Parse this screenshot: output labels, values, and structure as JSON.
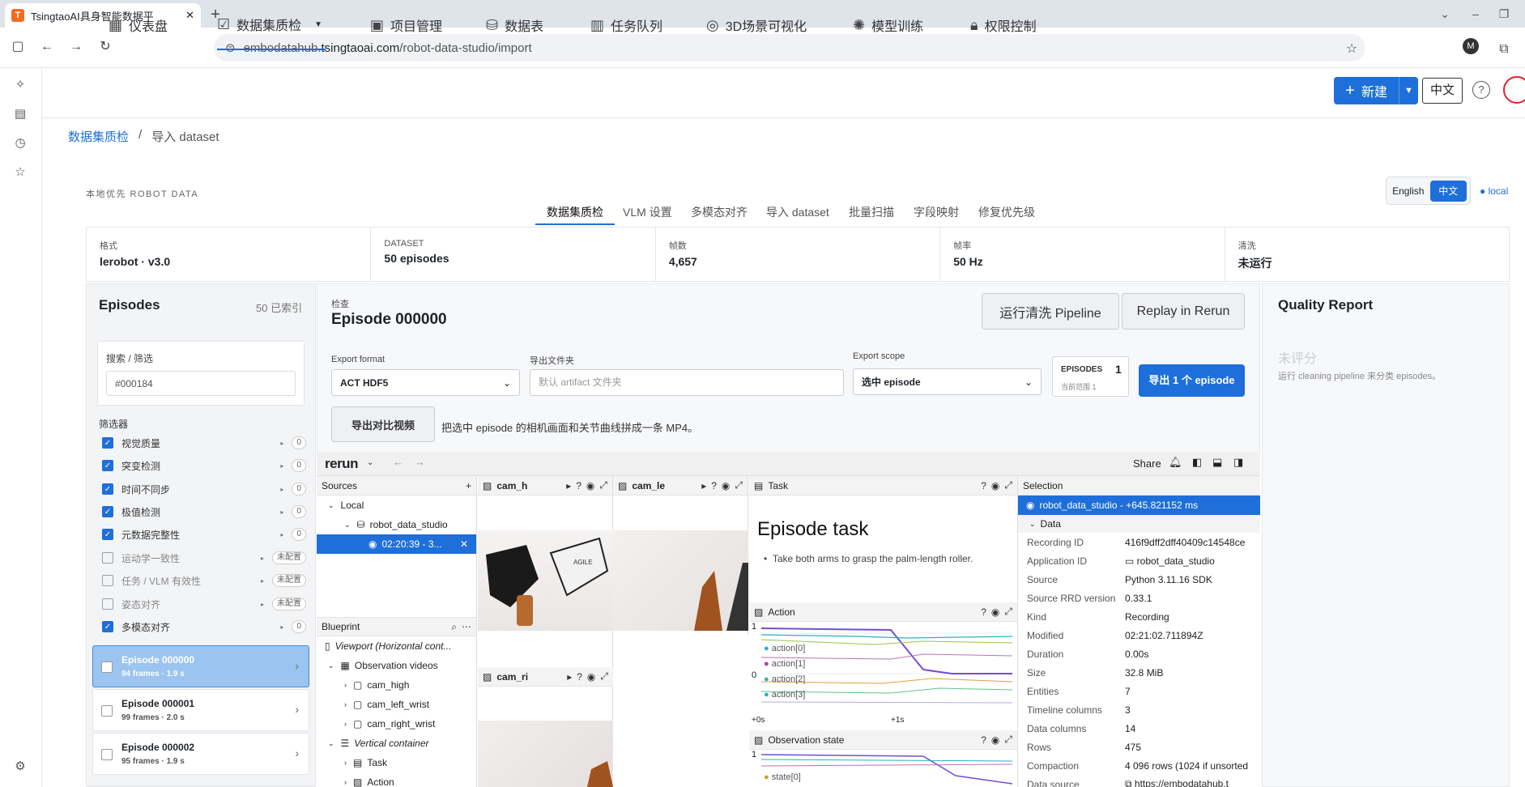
{
  "browser": {
    "tab_title": "TsingtaoAI具身智能数据平",
    "url_prefix": "embodatahub.",
    "url_host": "tsingtaoai.com",
    "url_path": "/robot-data-studio/import",
    "profile": "M"
  },
  "nav": {
    "items": [
      "仪表盘",
      "数据集质检",
      "项目管理",
      "数据表",
      "任务队列",
      "3D场景可视化",
      "模型训练",
      "权限控制"
    ],
    "new_label": "新建",
    "lang": "中文"
  },
  "breadcrumb": {
    "parent": "数据集质检",
    "sep": "/",
    "current": "导入 dataset"
  },
  "studio": {
    "brand": "本地优先 ROBOT DATA",
    "tabs": [
      "数据集质检",
      "VLM 设置",
      "多模态对齐",
      "导入 dataset",
      "批量扫描",
      "字段映射",
      "修复优先级"
    ],
    "lang_en": "English",
    "lang_zh": "中文",
    "local": "local"
  },
  "stats": [
    {
      "k": "格式",
      "v": "lerobot · v3.0"
    },
    {
      "k": "DATASET",
      "v": "50 episodes"
    },
    {
      "k": "帧数",
      "v": "4,657"
    },
    {
      "k": "帧率",
      "v": "50 Hz"
    },
    {
      "k": "清洗",
      "v": "未运行"
    }
  ],
  "episodes": {
    "title": "Episodes",
    "count": "50 已索引",
    "search_label": "搜索 / 筛选",
    "search_value": "#000184",
    "filter_label": "筛选器",
    "filters": [
      {
        "name": "视觉质量",
        "on": true,
        "badge": "0"
      },
      {
        "name": "突变检测",
        "on": true,
        "badge": "0"
      },
      {
        "name": "时间不同步",
        "on": true,
        "badge": "0"
      },
      {
        "name": "极值检测",
        "on": true,
        "badge": "0"
      },
      {
        "name": "元数据完整性",
        "on": true,
        "badge": "0"
      },
      {
        "name": "运动学一致性",
        "on": false,
        "badge": "未配置"
      },
      {
        "name": "任务 / VLM 有效性",
        "on": false,
        "badge": "未配置"
      },
      {
        "name": "姿态对齐",
        "on": false,
        "badge": "未配置"
      },
      {
        "name": "多模态对齐",
        "on": true,
        "badge": "0"
      }
    ],
    "list": [
      {
        "name": "Episode 000000",
        "meta": "94 frames · 1.9 s"
      },
      {
        "name": "Episode 000001",
        "meta": "99 frames · 2.0 s"
      },
      {
        "name": "Episode 000002",
        "meta": "95 frames · 1.9 s"
      }
    ]
  },
  "detail": {
    "inspect": "检查",
    "title": "Episode 000000",
    "run_pipeline": "运行清洗 Pipeline",
    "replay": "Replay in Rerun",
    "export_format_label": "Export format",
    "export_format": "ACT HDF5",
    "folder_label": "导出文件夹",
    "folder_placeholder": "默认 artifact 文件夹",
    "scope_label": "Export scope",
    "scope": "选中 episode",
    "ep_label": "EPISODES",
    "ep_count": "1",
    "ep_sub": "当前范围 1",
    "export_btn": "导出 1 个 episode",
    "video_btn": "导出对比视频",
    "video_desc": "把选中 episode 的相机画面和关节曲线拼成一条 MP4。"
  },
  "rerun": {
    "logo": "rerun",
    "share": "Share",
    "sources": "Sources",
    "local": "Local",
    "app": "robot_data_studio",
    "recording": "02:20:39 - 3...",
    "blueprint": "Blueprint",
    "bp_items": [
      "Viewport (Horizontal cont...",
      "Observation videos",
      "cam_high",
      "cam_left_wrist",
      "cam_right_wrist",
      "Vertical container",
      "Task",
      "Action"
    ],
    "cam1": "cam_h",
    "cam2": "cam_le",
    "cam3": "cam_ri",
    "task_tab": "Task",
    "task_title": "Episode task",
    "task_text": "Take both arms to grasp the palm-length roller.",
    "action_tab": "Action",
    "action_series": [
      "action[0]",
      "action[1]",
      "action[2]",
      "action[3]"
    ],
    "action_y1": "1",
    "action_y0": "0",
    "t0": "+0s",
    "t1": "+1s",
    "obs_tab": "Observation state",
    "obs_y1": "1",
    "obs_series": [
      "state[0]"
    ],
    "selection": "Selection",
    "sel_item": "robot_data_studio - +645.821152 ms",
    "data_hdr": "Data",
    "props": [
      {
        "k": "Recording ID",
        "v": "416f9dff2dff40409c14548ce"
      },
      {
        "k": "Application ID",
        "v": "robot_data_studio"
      },
      {
        "k": "Source",
        "v": "Python 3.11.16 SDK"
      },
      {
        "k": "Source RRD version",
        "v": "0.33.1"
      },
      {
        "k": "Kind",
        "v": "Recording"
      },
      {
        "k": "Modified",
        "v": "02:21:02.711894Z"
      },
      {
        "k": "Duration",
        "v": "0.00s"
      },
      {
        "k": "Size",
        "v": "32.8 MiB"
      },
      {
        "k": "Entities",
        "v": "7"
      },
      {
        "k": "Timeline columns",
        "v": "3"
      },
      {
        "k": "Data columns",
        "v": "14"
      },
      {
        "k": "Rows",
        "v": "475"
      },
      {
        "k": "Compaction",
        "v": "4 096 rows (1024 if unsorted"
      },
      {
        "k": "Data source",
        "v": "https://embodatahub.t"
      }
    ]
  },
  "quality": {
    "title": "Quality Report",
    "state": "未评分",
    "desc": "运行 cleaning pipeline 来分类 episodes。"
  },
  "colors": {
    "accent": "#1e6fd9",
    "series": [
      "#2ab0c5",
      "#b03aa8",
      "#2ab0c5",
      "#2ab0c5"
    ]
  }
}
